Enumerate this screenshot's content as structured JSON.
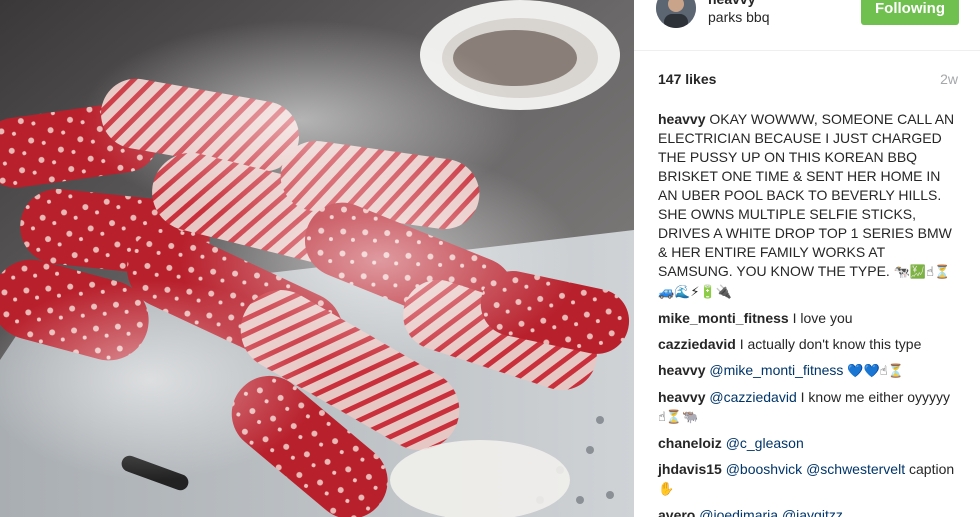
{
  "post": {
    "username": "heavvy",
    "location": "parks bbq",
    "follow_label": "Following",
    "likes": "147 likes",
    "age": "2w"
  },
  "comments": [
    {
      "user": "heavvy",
      "text": "OKAY WOWWW, SOMEONE CALL AN ELECTRICIAN BECAUSE I JUST CHARGED THE PUSSY UP ON THIS KOREAN BBQ BRISKET ONE TIME & SENT HER HOME IN AN UBER POOL BACK TO BEVERLY HILLS. SHE OWNS MULTIPLE SELFIE STICKS, DRIVES A WHITE DROP TOP 1 SERIES BMW & HER ENTIRE FAMILY WORKS AT SAMSUNG. YOU KNOW THE TYPE.",
      "emoji": "🐄💹☝⏳🚙🌊⚡🔋🔌"
    },
    {
      "user": "mike_monti_fitness",
      "text": "I love you"
    },
    {
      "user": "cazziedavid",
      "text": "I actually don't know this type"
    },
    {
      "user": "heavvy",
      "mention": "@mike_monti_fitness",
      "emoji": "💙💙☝⏳"
    },
    {
      "user": "heavvy",
      "mention": "@cazziedavid",
      "text": "I know me either oyyyyy",
      "emoji": "☝⏳🐃"
    },
    {
      "user": "chaneloiz",
      "mention": "@c_gleason"
    },
    {
      "user": "jhdavis15",
      "mention": "@booshvick",
      "mention2": "@schwestervelt",
      "text": "caption",
      "emoji": "✋"
    },
    {
      "user": "avero",
      "mention": "@joedimaria",
      "mention2": "@jaygitzz"
    }
  ],
  "icons": {
    "avatar": "user-avatar"
  },
  "colors": {
    "follow_bg": "#70c050",
    "mention": "#003569",
    "muted": "#a5a7aa"
  }
}
